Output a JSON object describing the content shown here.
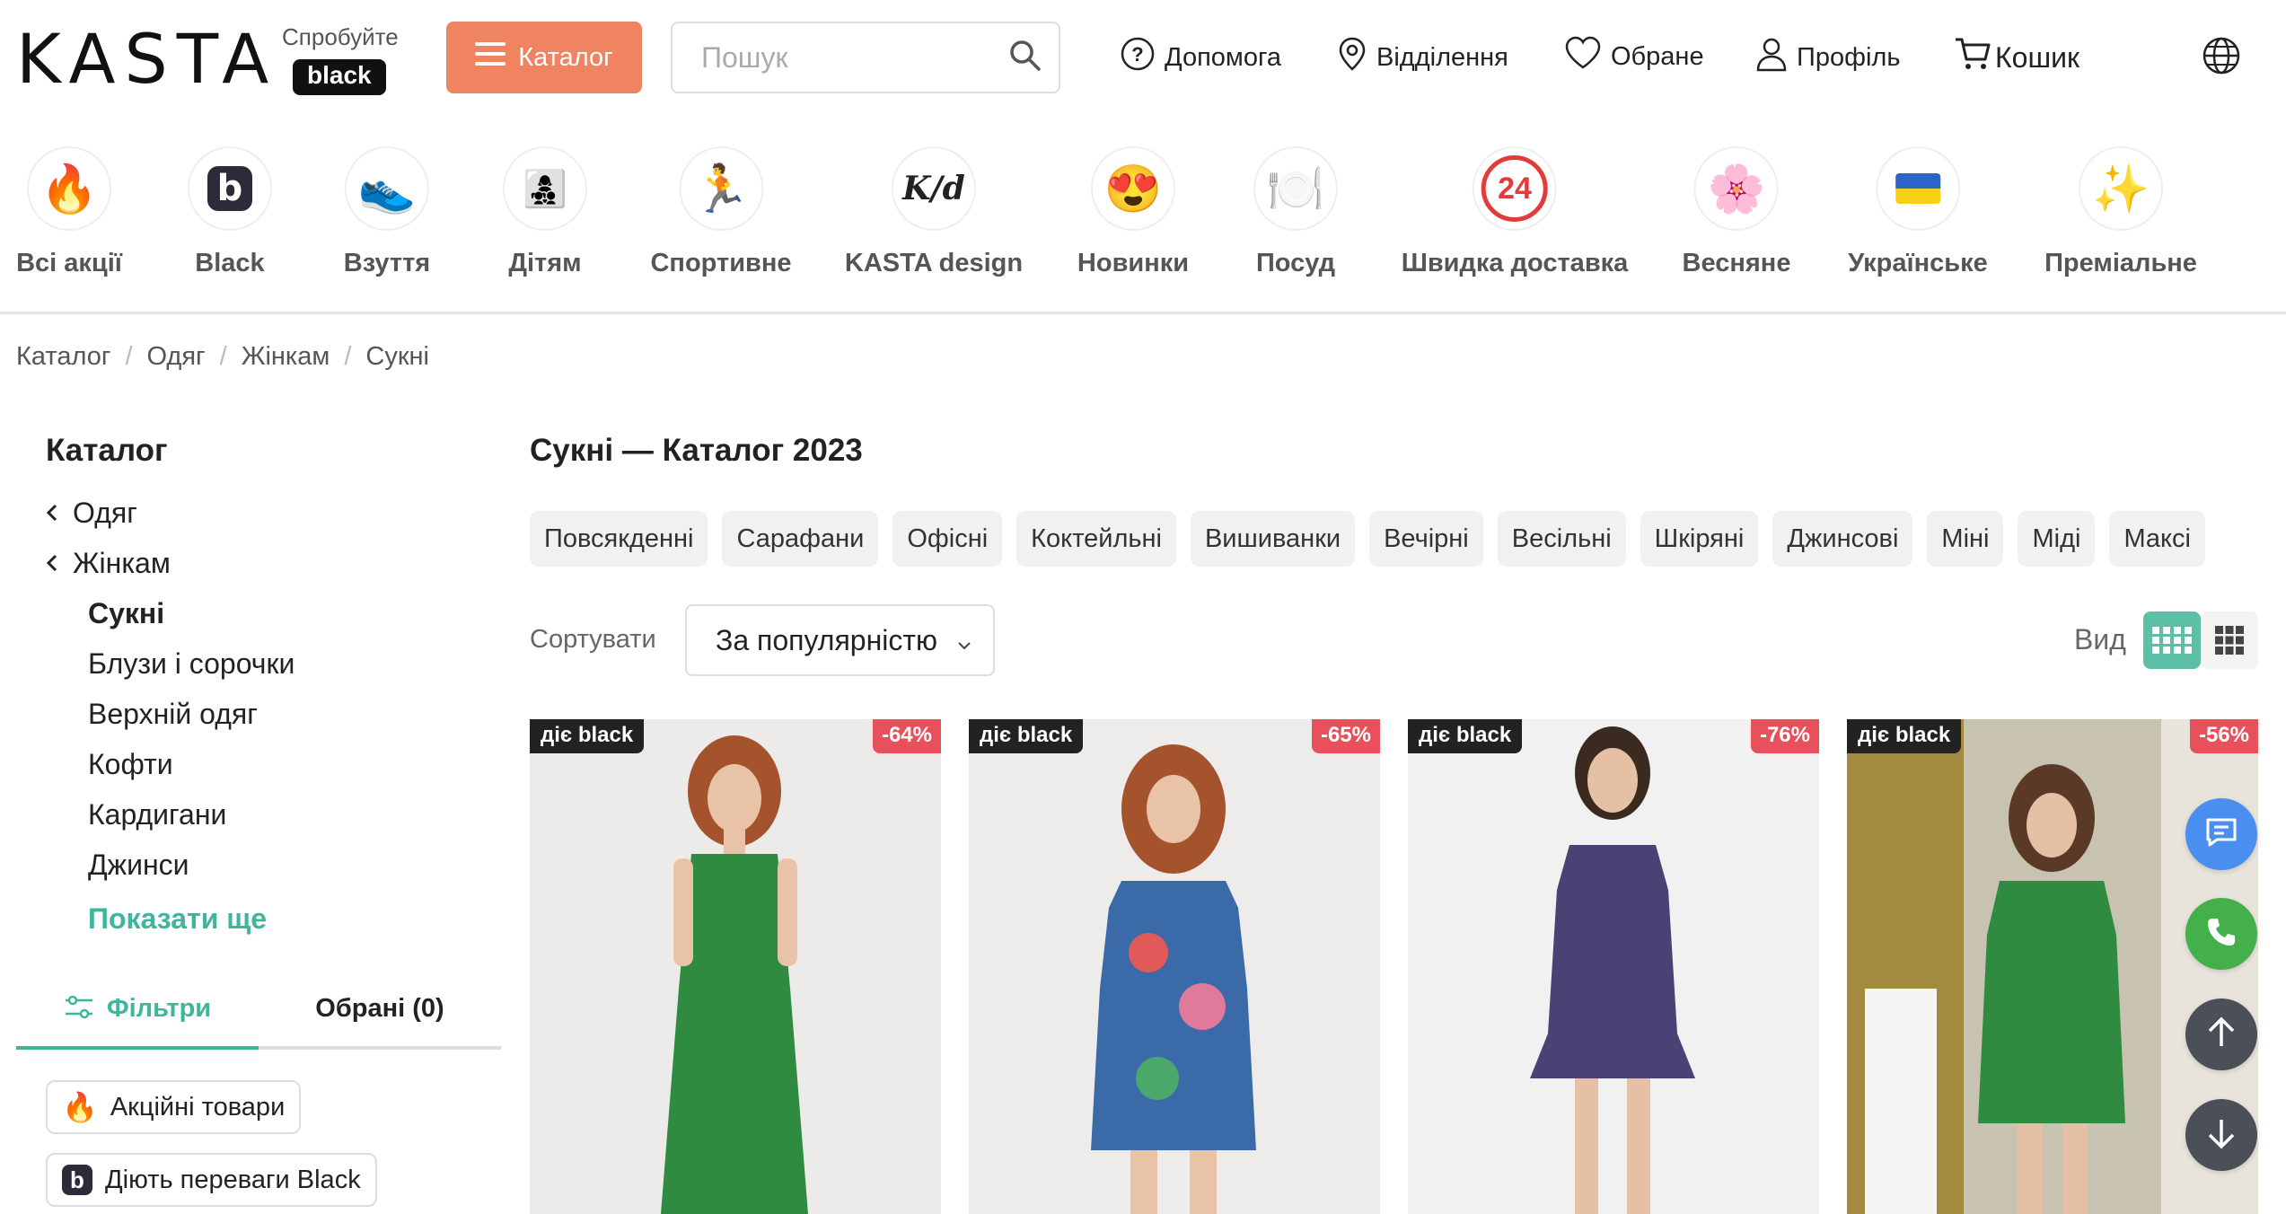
{
  "header": {
    "logo": "KASTA",
    "try_text": "Спробуйте",
    "black_badge": "black",
    "catalog_label": "Каталог",
    "search_placeholder": "Пошук",
    "nav": {
      "help": "Допомога",
      "branches": "Відділення",
      "favorites": "Обране",
      "profile": "Профіль",
      "cart": "Кошик"
    }
  },
  "categories": [
    {
      "label": "Всі акції",
      "icon": "fire-icon",
      "glyph": "🔥"
    },
    {
      "label": "Black",
      "icon": "black-b-icon",
      "glyph": "b"
    },
    {
      "label": "Взуття",
      "icon": "sneaker-icon",
      "glyph": "👟"
    },
    {
      "label": "Дітям",
      "icon": "family-icon",
      "glyph": "👩‍👧‍👦"
    },
    {
      "label": "Спортивне",
      "icon": "runner-icon",
      "glyph": "🏃"
    },
    {
      "label": "KASTA design",
      "icon": "kd-logo-icon",
      "glyph": "K/d"
    },
    {
      "label": "Новинки",
      "icon": "heart-eyes-icon",
      "glyph": "😍"
    },
    {
      "label": "Посуд",
      "icon": "plate-icon",
      "glyph": "🍽️"
    },
    {
      "label": "Швидка доставка",
      "icon": "24h-icon",
      "glyph": "24"
    },
    {
      "label": "Весняне",
      "icon": "flower-icon",
      "glyph": "🌸"
    },
    {
      "label": "Українське",
      "icon": "ukraine-flag-icon",
      "glyph": "🇺🇦"
    },
    {
      "label": "Преміальне",
      "icon": "sparkles-icon",
      "glyph": "✨"
    }
  ],
  "breadcrumb": [
    "Каталог",
    "Одяг",
    "Жінкам",
    "Сукні"
  ],
  "sidebar": {
    "title": "Каталог",
    "back_items": [
      "Одяг",
      "Жінкам"
    ],
    "items": [
      "Сукні",
      "Блузи і сорочки",
      "Верхній одяг",
      "Кофти",
      "Кардигани",
      "Джинси"
    ],
    "show_more": "Показати ще",
    "tabs": {
      "filters": "Фільтри",
      "favorites": "Обрані (0)"
    },
    "filter_chips": [
      "Акційні товари",
      "Діють переваги Black"
    ]
  },
  "main": {
    "title": "Сукні — Каталог 2023",
    "tags": [
      "Повсякденні",
      "Сарафани",
      "Офісні",
      "Коктейльні",
      "Вишиванки",
      "Вечірні",
      "Весільні",
      "Шкіряні",
      "Джинсові",
      "Міні",
      "Міді",
      "Максі"
    ],
    "sort_label": "Сортувати",
    "sort_value": "За популярністю",
    "view_label": "Вид"
  },
  "products": [
    {
      "badge": "діє black",
      "discount": "-64%",
      "bg": "#ecebea",
      "dress": "#2e8b3f"
    },
    {
      "badge": "діє black",
      "discount": "-65%",
      "bg": "#eeeceb",
      "dress": "#3a6aa8"
    },
    {
      "badge": "діє black",
      "discount": "-76%",
      "bg": "#f1f1f2",
      "dress": "#4a4274"
    },
    {
      "badge": "діє black",
      "discount": "-56%",
      "bg": "#c8c2b0",
      "dress": "#2e8b3f"
    }
  ],
  "colors": {
    "accent": "#f08460",
    "green": "#3fb59c",
    "discount": "#e8505b"
  }
}
